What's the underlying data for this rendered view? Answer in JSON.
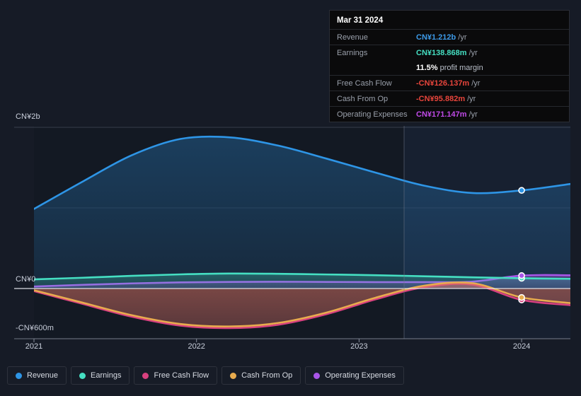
{
  "chart_data": {
    "type": "area",
    "title": "",
    "xlabel": "",
    "ylabel": "",
    "currency": "CN¥",
    "grid": true,
    "legend_position": "bottom",
    "x_ticks": [
      "2021",
      "2022",
      "2023",
      "2024"
    ],
    "y_ticks": [
      "CN¥2b",
      "CN¥0",
      "-CN¥600m"
    ],
    "ylim": [
      -600000000,
      2000000000
    ],
    "xlim": [
      "2021",
      "2024.3"
    ],
    "forecast_divider_x": "2023.25",
    "series": [
      {
        "name": "Revenue",
        "color": "#2e95e6",
        "x": [
          2021.0,
          2021.3,
          2021.6,
          2021.9,
          2022.2,
          2022.5,
          2022.8,
          2023.1,
          2023.4,
          2023.7,
          2024.0,
          2024.3
        ],
        "values": [
          985000000,
          1320000000,
          1640000000,
          1840000000,
          1860000000,
          1760000000,
          1600000000,
          1430000000,
          1270000000,
          1180000000,
          1212000000,
          1290000000
        ],
        "last_value": 1212000000
      },
      {
        "name": "Earnings",
        "color": "#45dfc2",
        "x": [
          2021.0,
          2021.3,
          2021.6,
          2021.9,
          2022.2,
          2022.5,
          2022.8,
          2023.1,
          2023.4,
          2023.7,
          2024.0,
          2024.3
        ],
        "values": [
          125000000,
          145000000,
          168000000,
          186000000,
          196000000,
          193000000,
          185000000,
          176000000,
          163000000,
          150000000,
          138868000,
          132000000
        ],
        "last_value": 138868000
      },
      {
        "name": "Free Cash Flow",
        "color": "#d8417f",
        "x": [
          2021.0,
          2021.3,
          2021.6,
          2021.9,
          2022.2,
          2022.5,
          2022.8,
          2023.1,
          2023.4,
          2023.7,
          2024.0,
          2024.3
        ],
        "values": [
          -18000000,
          -175000000,
          -330000000,
          -440000000,
          -470000000,
          -430000000,
          -300000000,
          -120000000,
          30000000,
          60000000,
          -126137000,
          -190000000
        ],
        "last_value": -126137000
      },
      {
        "name": "Cash From Op",
        "color": "#e8ab4e",
        "x": [
          2021.0,
          2021.3,
          2021.6,
          2021.9,
          2022.2,
          2022.5,
          2022.8,
          2023.1,
          2023.4,
          2023.7,
          2024.0,
          2024.3
        ],
        "values": [
          -8000000,
          -160000000,
          -312000000,
          -420000000,
          -450000000,
          -408000000,
          -280000000,
          -100000000,
          48000000,
          78000000,
          -95882000,
          -165000000
        ],
        "last_value": -95882000
      },
      {
        "name": "Operating Expenses",
        "color": "#a855e8",
        "x": [
          2021.0,
          2021.3,
          2021.6,
          2021.9,
          2022.2,
          2022.5,
          2022.8,
          2023.1,
          2023.4,
          2023.7,
          2024.0,
          2024.3
        ],
        "values": [
          38000000,
          58000000,
          76000000,
          88000000,
          94000000,
          96000000,
          94000000,
          92000000,
          92000000,
          98000000,
          171147000,
          175000000
        ],
        "last_value": 171147000
      }
    ]
  },
  "axis": {
    "y_top_label": "CN¥2b",
    "y_zero_label": "CN¥0",
    "y_bottom_label": "-CN¥600m",
    "x_labels": [
      {
        "label": "2021"
      },
      {
        "label": "2022"
      },
      {
        "label": "2023"
      },
      {
        "label": "2024"
      }
    ]
  },
  "tooltip": {
    "date": "Mar 31 2024",
    "rows": [
      {
        "key": "Revenue",
        "value": "CN¥1.212b",
        "unit": "/yr",
        "color": "#3d9ae8"
      },
      {
        "key": "Earnings",
        "value": "CN¥138.868m",
        "unit": "/yr",
        "color": "#45dfc2"
      },
      {
        "key": "",
        "value": "11.5%",
        "sub": "profit margin",
        "color": "#ffffff"
      },
      {
        "key": "Free Cash Flow",
        "value": "-CN¥126.137m",
        "unit": "/yr",
        "color": "#e8453c"
      },
      {
        "key": "Cash From Op",
        "value": "-CN¥95.882m",
        "unit": "/yr",
        "color": "#e8453c"
      },
      {
        "key": "Operating Expenses",
        "value": "CN¥171.147m",
        "unit": "/yr",
        "color": "#c04ae8"
      }
    ]
  },
  "legend": {
    "items": [
      {
        "label": "Revenue",
        "color": "#2e95e6"
      },
      {
        "label": "Earnings",
        "color": "#45dfc2"
      },
      {
        "label": "Free Cash Flow",
        "color": "#d8417f"
      },
      {
        "label": "Cash From Op",
        "color": "#e8ab4e"
      },
      {
        "label": "Operating Expenses",
        "color": "#a855e8"
      }
    ]
  }
}
